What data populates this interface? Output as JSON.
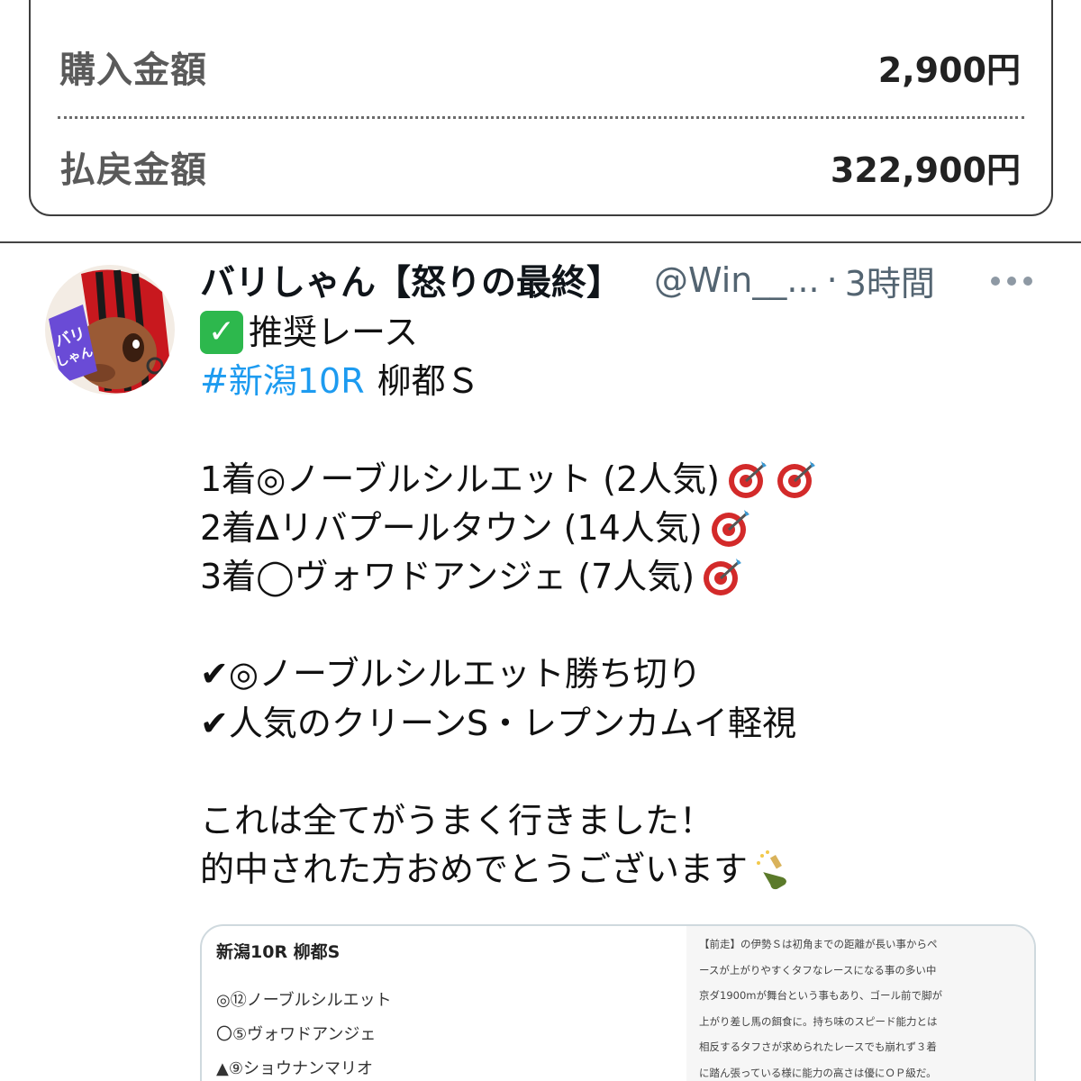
{
  "receipt": {
    "purchase_label": "購入金額",
    "purchase_amount": "2,900円",
    "payout_label": "払戻金額",
    "payout_amount": "322,900円"
  },
  "tweet": {
    "display_name": "バリしゃん【怒りの最終】",
    "handle": "@Win__...",
    "separator": "·",
    "timestamp": "3時間",
    "avatar_text": "バリしゃん",
    "lines": {
      "recommend": "推奨レース",
      "hashtag": "#新潟10R",
      "race_name": "柳都Ｓ",
      "result1": "1着◎ノーブルシルエット (2人気)",
      "result2": "2着∆リバプールタウン (14人気)",
      "result3": "3着◯ヴォワドアンジェ (7人気)",
      "point1": "✔◎ノーブルシルエット勝ち切り",
      "point2": "✔人気のクリーンS・レプンカムイ軽視",
      "closing1": "これは全てがうまく行きました！",
      "closing2": "的中された方おめでとうございます"
    },
    "icons": {
      "check_emoji": "check-mark-button",
      "target_emoji": "direct-hit",
      "champagne_emoji": "bottle-with-popping-cork"
    }
  },
  "media": {
    "title": "新潟10R 柳都S",
    "picks": [
      "◎⑫ノーブルシルエット",
      "〇⑤ヴォワドアンジェ",
      "▲⑨ショウナンマリオ"
    ],
    "analysis_lines": [
      "【前走】の伊勢Ｓは初角までの距離が長い事からペ",
      "ースが上がりやすくタフなレースになる事の多い中",
      "京ダ1900mが舞台という事もあり、ゴール前で脚が",
      "上がり差し馬の餌食に。持ち味のスピード能力とは",
      "相反するタフさが求められたレースでも崩れず３着",
      "に踏ん張っている様に能力の高さは優にＯＰ級だ。"
    ]
  },
  "colors": {
    "link": "#1d9bf0",
    "muted": "#536471",
    "check_green": "#2db84d"
  }
}
